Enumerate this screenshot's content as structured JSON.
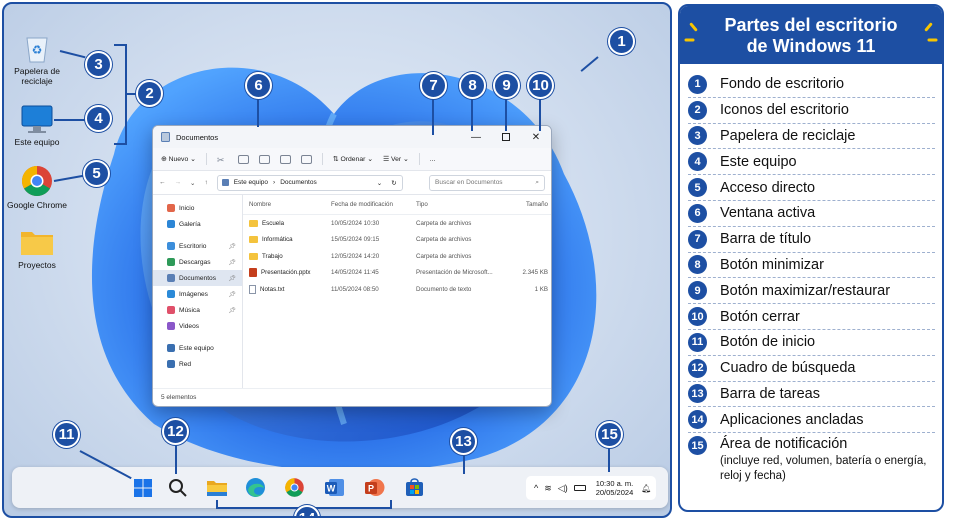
{
  "desktop": {
    "icons": [
      {
        "label": "Papelera de reciclaje"
      },
      {
        "label": "Este equipo"
      },
      {
        "label": "Google Chrome"
      },
      {
        "label": "Proyectos"
      }
    ]
  },
  "badges": [
    "1",
    "2",
    "3",
    "4",
    "5",
    "6",
    "7",
    "8",
    "9",
    "10",
    "11",
    "12",
    "13",
    "14",
    "15"
  ],
  "window": {
    "title": "Documentos",
    "commands": {
      "new": "Nuevo",
      "sort": "Ordenar",
      "view": "Ver",
      "more": "..."
    },
    "address": {
      "root": "Este equipo",
      "folder": "Documentos",
      "search_placeholder": "Buscar en Documentos"
    },
    "nav": [
      {
        "label": "Inicio",
        "color": "#e2664a",
        "pinned": false,
        "selected": false
      },
      {
        "label": "Galería",
        "color": "#2c86d6",
        "pinned": false,
        "selected": false
      },
      {
        "label": "Escritorio",
        "color": "#3c8edb",
        "pinned": true,
        "selected": false
      },
      {
        "label": "Descargas",
        "color": "#2e9a59",
        "pinned": true,
        "selected": false
      },
      {
        "label": "Documentos",
        "color": "#5a7fb5",
        "pinned": true,
        "selected": true
      },
      {
        "label": "Imágenes",
        "color": "#2b8ad8",
        "pinned": true,
        "selected": false
      },
      {
        "label": "Música",
        "color": "#e0506a",
        "pinned": true,
        "selected": false
      },
      {
        "label": "Videos",
        "color": "#8a57c9",
        "pinned": false,
        "selected": false
      },
      {
        "label": "Este equipo",
        "color": "#3a6fb0",
        "pinned": false,
        "selected": false
      },
      {
        "label": "Red",
        "color": "#3a6fb0",
        "pinned": false,
        "selected": false
      }
    ],
    "columns": {
      "name": "Nombre",
      "modified": "Fecha de modificación",
      "type": "Tipo",
      "size": "Tamaño"
    },
    "files": [
      {
        "name": "Escuela",
        "modified": "10/05/2024 10:30",
        "type": "Carpeta de archivos",
        "size": "",
        "kind": "folder"
      },
      {
        "name": "Informática",
        "modified": "15/05/2024 09:15",
        "type": "Carpeta de archivos",
        "size": "",
        "kind": "folder"
      },
      {
        "name": "Trabajo",
        "modified": "12/05/2024 14:20",
        "type": "Carpeta de archivos",
        "size": "",
        "kind": "folder"
      },
      {
        "name": "Presentación.pptx",
        "modified": "14/05/2024 11:45",
        "type": "Presentación de Microsoft...",
        "size": "2.345 KB",
        "kind": "pptx"
      },
      {
        "name": "Notas.txt",
        "modified": "11/05/2024 08:50",
        "type": "Documento de texto",
        "size": "1 KB",
        "kind": "txt"
      }
    ],
    "status": "5 elementos"
  },
  "taskbar": {
    "apps": [
      "windows-start-icon",
      "search-icon",
      "file-explorer-icon",
      "edge-icon",
      "chrome-icon",
      "word-icon",
      "powerpoint-icon",
      "store-icon"
    ],
    "tray": {
      "chevron": "^",
      "time": "10:30 a. m.",
      "date": "20/05/2024"
    }
  },
  "legend": {
    "title_line1": "Partes del escritorio",
    "title_line2": "de Windows 11",
    "items": [
      {
        "n": "1",
        "label": "Fondo de escritorio"
      },
      {
        "n": "2",
        "label": "Iconos del escritorio"
      },
      {
        "n": "3",
        "label": "Papelera de reciclaje"
      },
      {
        "n": "4",
        "label": "Este equipo"
      },
      {
        "n": "5",
        "label": "Acceso directo"
      },
      {
        "n": "6",
        "label": "Ventana activa"
      },
      {
        "n": "7",
        "label": "Barra de título"
      },
      {
        "n": "8",
        "label": "Botón minimizar"
      },
      {
        "n": "9",
        "label": "Botón maximizar/restaurar"
      },
      {
        "n": "10",
        "label": "Botón cerrar"
      },
      {
        "n": "11",
        "label": "Botón de inicio"
      },
      {
        "n": "12",
        "label": "Cuadro de búsqueda"
      },
      {
        "n": "13",
        "label": "Barra de tareas"
      },
      {
        "n": "14",
        "label": "Aplicaciones ancladas"
      },
      {
        "n": "15",
        "label": "Área de notificación"
      }
    ],
    "note": "(incluye red, volumen, batería o energía, reloj y fecha)"
  },
  "colors": {
    "accent": "#1d4fa3",
    "highlight": "#f7c500"
  }
}
